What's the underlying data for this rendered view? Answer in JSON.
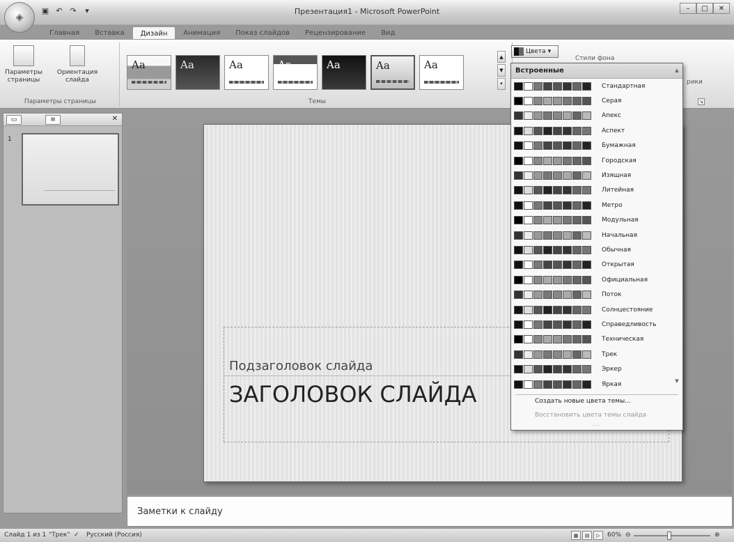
{
  "window": {
    "title": "Презентация1 - Microsoft PowerPoint"
  },
  "tabs": [
    {
      "label": "Главная"
    },
    {
      "label": "Вставка"
    },
    {
      "label": "Дизайн"
    },
    {
      "label": "Анимация"
    },
    {
      "label": "Показ слайдов"
    },
    {
      "label": "Рецензирование"
    },
    {
      "label": "Вид"
    }
  ],
  "ribbon": {
    "page_setup": {
      "params_label": "Параметры страницы",
      "orientation_label": "Ориентация слайда",
      "group_label": "Параметры страницы"
    },
    "themes": {
      "group_label": "Темы",
      "items": [
        {
          "sample": "Aa"
        },
        {
          "sample": "Aa"
        },
        {
          "sample": "Aa"
        },
        {
          "sample": "Aa"
        },
        {
          "sample": "Aa"
        },
        {
          "sample": "Aa"
        },
        {
          "sample": "Aa"
        }
      ]
    },
    "colors_button": "Цвета",
    "background_styles": "Стили фона",
    "hide_background": "рики"
  },
  "colors_dropdown": {
    "header": "Встроенные",
    "schemes": [
      {
        "name": "Стандартная"
      },
      {
        "name": "Серая"
      },
      {
        "name": "Апекс"
      },
      {
        "name": "Аспект"
      },
      {
        "name": "Бумажная"
      },
      {
        "name": "Городская"
      },
      {
        "name": "Изящная"
      },
      {
        "name": "Литейная"
      },
      {
        "name": "Метро"
      },
      {
        "name": "Модульная"
      },
      {
        "name": "Начальная"
      },
      {
        "name": "Обычная"
      },
      {
        "name": "Открытая"
      },
      {
        "name": "Официальная"
      },
      {
        "name": "Поток"
      },
      {
        "name": "Солнцестояние"
      },
      {
        "name": "Справедливость"
      },
      {
        "name": "Техническая"
      },
      {
        "name": "Трек"
      },
      {
        "name": "Эркер"
      },
      {
        "name": "Яркая"
      }
    ],
    "create_new": "Создать новые цвета темы...",
    "reset": "Восстановить цвета темы слайда"
  },
  "slide": {
    "subtitle": "Подзаголовок слайда",
    "title": "ЗАГОЛОВОК СЛАЙДА",
    "thumb_number": "1"
  },
  "notes": {
    "placeholder": "Заметки к слайду"
  },
  "status_bar": {
    "slide_info": "Слайд 1 из 1",
    "theme": "\"Трек\"",
    "language": "Русский (Россия)",
    "zoom": "60%"
  },
  "colors": {
    "ribbon_bg": "#e8e8e8",
    "slide_bg": "#ececec"
  }
}
